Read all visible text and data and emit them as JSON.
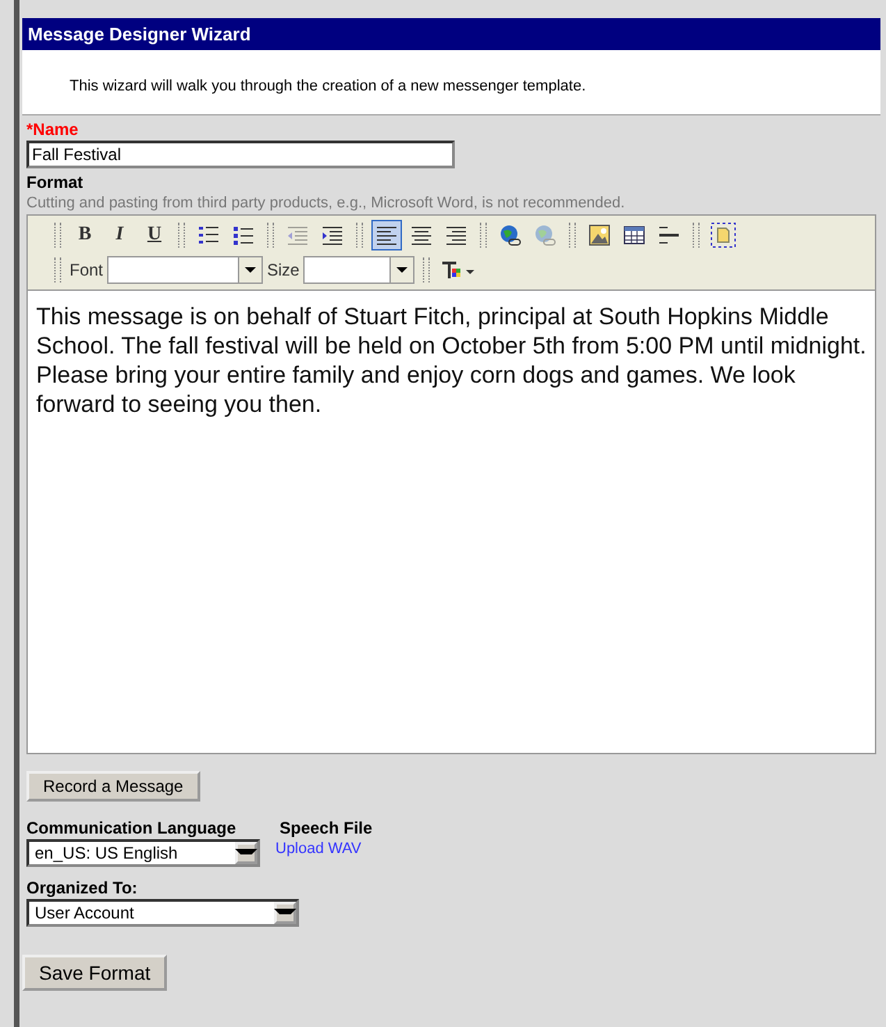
{
  "wizard": {
    "title": "Message Designer Wizard",
    "intro": "This wizard will walk you through the creation of a new messenger template."
  },
  "name_field": {
    "label": "*Name",
    "value": "Fall Festival"
  },
  "format": {
    "label": "Format",
    "hint": "Cutting and pasting from third party products, e.g., Microsoft Word, is not recommended."
  },
  "toolbar": [
    {
      "kind": "bold",
      "glyph": "B",
      "selected": false,
      "disabled": false,
      "group_start": true
    },
    {
      "kind": "italic",
      "glyph": "I",
      "selected": false,
      "disabled": false
    },
    {
      "kind": "underline",
      "glyph": "U",
      "selected": false,
      "disabled": false
    },
    {
      "kind": "ordered-list",
      "selected": false,
      "disabled": false,
      "group_start": true
    },
    {
      "kind": "bullet-list",
      "selected": false,
      "disabled": false
    },
    {
      "kind": "outdent",
      "selected": false,
      "disabled": true,
      "group_start": true
    },
    {
      "kind": "indent",
      "selected": false,
      "disabled": false
    },
    {
      "kind": "align-left",
      "selected": true,
      "disabled": false,
      "group_start": true
    },
    {
      "kind": "align-center",
      "selected": false,
      "disabled": false
    },
    {
      "kind": "align-right",
      "selected": false,
      "disabled": false
    },
    {
      "kind": "link",
      "selected": false,
      "disabled": false,
      "group_start": true
    },
    {
      "kind": "unlink",
      "selected": false,
      "disabled": true
    },
    {
      "kind": "image",
      "selected": false,
      "disabled": false,
      "group_start": true
    },
    {
      "kind": "table",
      "selected": false,
      "disabled": false
    },
    {
      "kind": "rule",
      "selected": false,
      "disabled": false
    },
    {
      "kind": "snippet",
      "selected": false,
      "disabled": false,
      "group_start": true
    }
  ],
  "font_select": {
    "label": "Font"
  },
  "size_select": {
    "label": "Size"
  },
  "message_body": "This message is on behalf of Stuart Fitch, principal at South Hopkins Middle School. The fall festival will be held on October 5th from 5:00 PM until midnight. Please bring your entire family and enjoy corn dogs and games. We look forward to seeing you then.",
  "record_button": "Record a Message",
  "language": {
    "label": "Communication Language",
    "value": "en_US: US English"
  },
  "speech_file": {
    "label": "Speech File",
    "link": "Upload WAV"
  },
  "organized_to": {
    "label": "Organized To:",
    "value": "User Account"
  },
  "save_button": "Save Format"
}
